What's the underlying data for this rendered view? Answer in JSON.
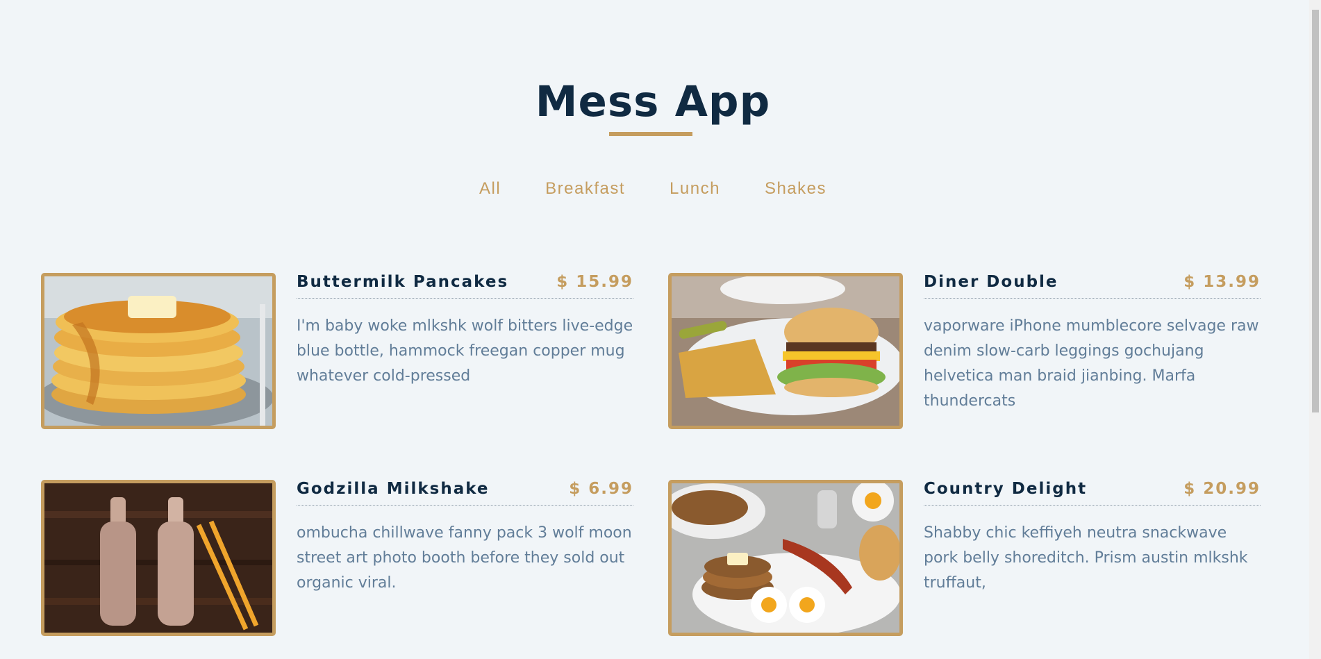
{
  "app": {
    "title": "Mess App"
  },
  "filters": [
    "All",
    "Breakfast",
    "Lunch",
    "Shakes"
  ],
  "menu": [
    {
      "name": "Buttermilk Pancakes",
      "price": "$ 15.99",
      "description": "I'm baby woke mlkshk wolf bitters live-edge blue bottle, hammock freegan copper mug whatever cold-pressed",
      "image": "pancakes-photo"
    },
    {
      "name": "Diner Double",
      "price": "$ 13.99",
      "description": "vaporware iPhone mumblecore selvage raw denim slow-carb leggings gochujang helvetica man braid jianbing. Marfa thundercats",
      "image": "burger-photo"
    },
    {
      "name": "Godzilla Milkshake",
      "price": "$ 6.99",
      "description": "ombucha chillwave fanny pack 3 wolf moon street art photo booth before they sold out organic viral.",
      "image": "milkshake-photo"
    },
    {
      "name": "Country Delight",
      "price": "$ 20.99",
      "description": "Shabby chic keffiyeh neutra snackwave pork belly shoreditch. Prism austin mlkshk truffaut,",
      "image": "breakfast-plate-photo"
    }
  ],
  "colors": {
    "background": "#f1f5f8",
    "primary": "#102a42",
    "accent": "#c59d5f",
    "text": "#617d98"
  }
}
